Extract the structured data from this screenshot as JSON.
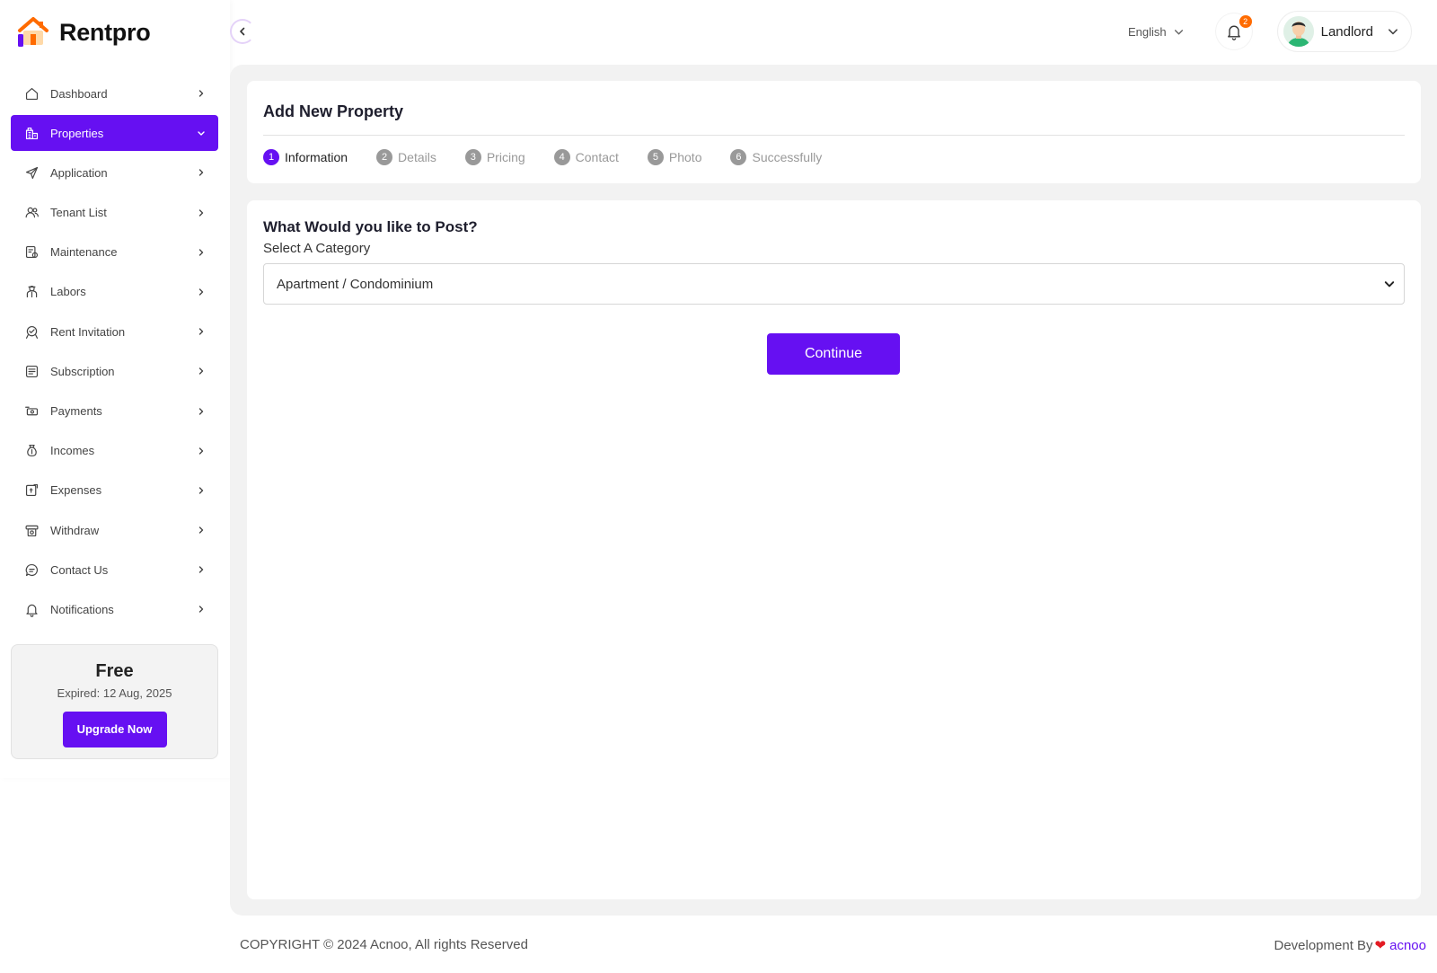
{
  "brand": {
    "name": "Rentpro"
  },
  "colors": {
    "accent": "#6610f2",
    "badge": "#ff6b00",
    "heart": "#e31b23"
  },
  "sidebar": {
    "items": [
      {
        "label": "Dashboard",
        "icon": "home-icon",
        "active": false
      },
      {
        "label": "Properties",
        "icon": "building-icon",
        "active": true
      },
      {
        "label": "Application",
        "icon": "send-icon",
        "active": false
      },
      {
        "label": "Tenant List",
        "icon": "users-icon",
        "active": false
      },
      {
        "label": "Maintenance",
        "icon": "maintenance-icon",
        "active": false
      },
      {
        "label": "Labors",
        "icon": "worker-icon",
        "active": false
      },
      {
        "label": "Rent Invitation",
        "icon": "invitation-icon",
        "active": false
      },
      {
        "label": "Subscription",
        "icon": "subscription-icon",
        "active": false
      },
      {
        "label": "Payments",
        "icon": "payment-icon",
        "active": false
      },
      {
        "label": "Incomes",
        "icon": "money-bag-icon",
        "active": false
      },
      {
        "label": "Expenses",
        "icon": "expense-icon",
        "active": false
      },
      {
        "label": "Withdraw",
        "icon": "withdraw-icon",
        "active": false
      },
      {
        "label": "Contact Us",
        "icon": "chat-icon",
        "active": false
      },
      {
        "label": "Notifications",
        "icon": "bell-icon",
        "active": false
      }
    ],
    "plan": {
      "title": "Free",
      "expired": "Expired: 12 Aug, 2025",
      "button": "Upgrade Now"
    }
  },
  "header": {
    "language": "English",
    "notification_count": "2",
    "user_name": "Landlord"
  },
  "steps_card": {
    "title": "Add New Property",
    "steps": [
      {
        "num": "1",
        "label": "Information",
        "active": true
      },
      {
        "num": "2",
        "label": "Details",
        "active": false
      },
      {
        "num": "3",
        "label": "Pricing",
        "active": false
      },
      {
        "num": "4",
        "label": "Contact",
        "active": false
      },
      {
        "num": "5",
        "label": "Photo",
        "active": false
      },
      {
        "num": "6",
        "label": "Successfully",
        "active": false
      }
    ]
  },
  "form": {
    "title": "What Would you like to Post?",
    "category_label": "Select A Category",
    "category_value": "Apartment / Condominium",
    "continue_label": "Continue"
  },
  "footer": {
    "copyright": "COPYRIGHT © 2024 Acnoo, All rights Reserved",
    "dev_prefix": "Development By",
    "dev_link": "acnoo"
  }
}
